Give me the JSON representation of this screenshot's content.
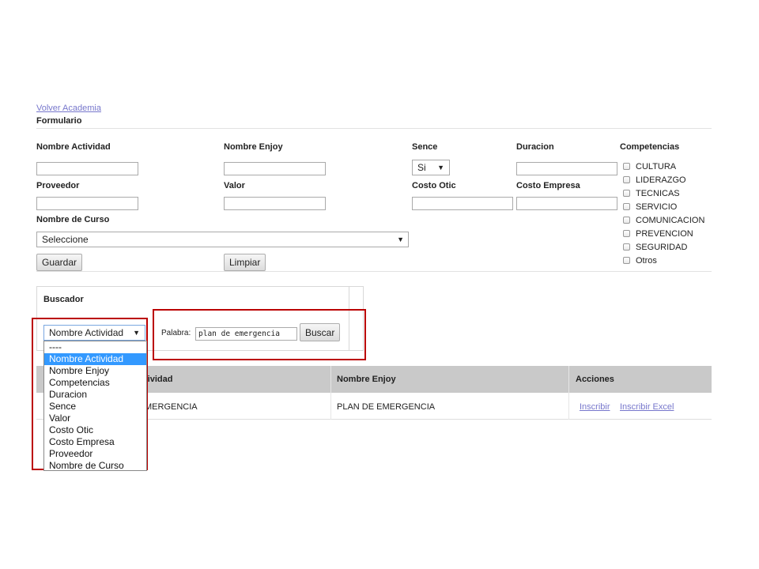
{
  "header": {
    "back_link": "Volver Academia",
    "form_title": "Formulario"
  },
  "form": {
    "nombre_actividad_label": "Nombre Actividad",
    "nombre_enjoy_label": "Nombre Enjoy",
    "sence_label": "Sence",
    "sence_value": "Si",
    "duracion_label": "Duracion",
    "proveedor_label": "Proveedor",
    "valor_label": "Valor",
    "costo_otic_label": "Costo Otic",
    "costo_empresa_label": "Costo Empresa",
    "nombre_curso_label": "Nombre de Curso",
    "nombre_curso_value": "Seleccione",
    "guardar_label": "Guardar",
    "limpiar_label": "Limpiar"
  },
  "competencias": {
    "label": "Competencias",
    "items": [
      "CULTURA",
      "LIDERAZGO",
      "TECNICAS",
      "SERVICIO",
      "COMUNICACION",
      "PREVENCION",
      "SEGURIDAD",
      "Otros"
    ]
  },
  "buscador": {
    "title": "Buscador",
    "field_select_value": "Nombre Actividad",
    "palabra_label": "Palabra:",
    "palabra_value": "plan de emergencia",
    "buscar_label": "Buscar",
    "options": [
      "----",
      "Nombre Actividad",
      "Nombre Enjoy",
      "Competencias",
      "Duracion",
      "Sence",
      "Valor",
      "Costo Otic",
      "Costo Empresa",
      "Proveedor",
      "Nombre de Curso"
    ],
    "selected_option": "Nombre Actividad"
  },
  "results": {
    "headers": [
      "Nombre Actividad",
      "Nombre Enjoy",
      "Acciones"
    ],
    "visible_header_fragment": "tividad",
    "rows": [
      {
        "nombre_actividad": "PLAN DE EMERGENCIA",
        "visible_fragment": "MERGENCIA",
        "nombre_enjoy": "PLAN DE EMERGENCIA",
        "action_inscribir": "Inscribir",
        "action_inscribir_excel": "Inscribir Excel"
      }
    ]
  },
  "colors": {
    "link": "#7777cc",
    "highlight_box": "#bb0000",
    "selected_option_bg": "#3399ff",
    "table_header_bg": "#c9c9c9"
  }
}
